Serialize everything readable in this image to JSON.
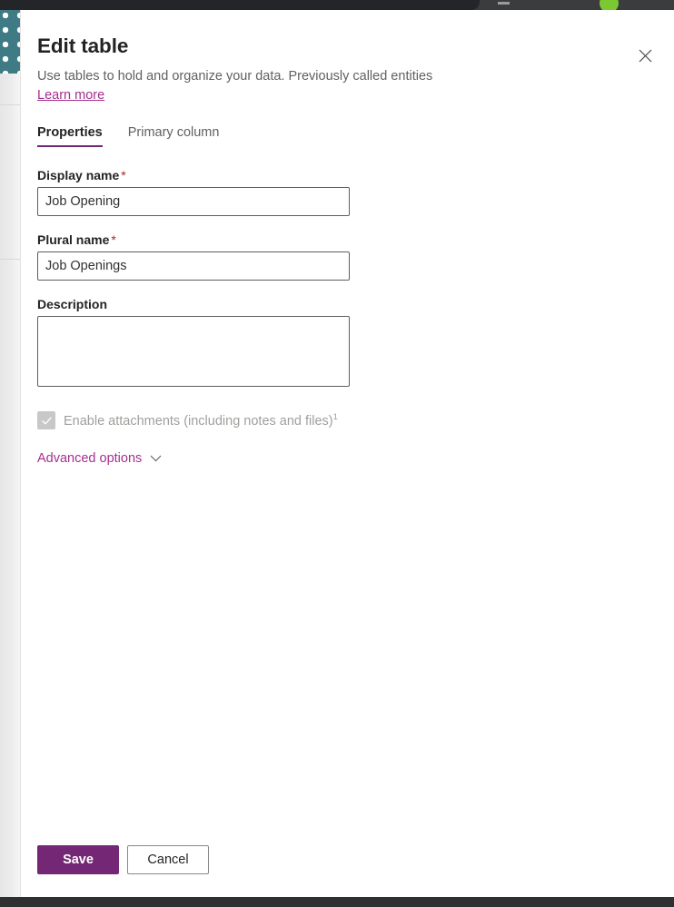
{
  "browser": {
    "account_indicator": "account-avatar-dot",
    "minimize_glyph": "minimize-icon"
  },
  "panel": {
    "title": "Edit table",
    "subtitle": "Use tables to hold and organize your data. Previously called entities",
    "learn_more_label": "Learn more",
    "close_icon_name": "close-icon",
    "tabs": [
      {
        "label": "Properties",
        "active": true
      },
      {
        "label": "Primary column",
        "active": false
      }
    ],
    "fields": {
      "display_name": {
        "label": "Display name",
        "required_marker": "*",
        "value": "Job Opening",
        "placeholder": ""
      },
      "plural_name": {
        "label": "Plural name",
        "required_marker": "*",
        "value": "Job Openings",
        "placeholder": ""
      },
      "description": {
        "label": "Description",
        "value": "",
        "placeholder": ""
      }
    },
    "attachments": {
      "label": "Enable attachments (including notes and files)",
      "footnote_marker": "1",
      "checked": true,
      "disabled": true
    },
    "advanced_options": {
      "label": "Advanced options",
      "chevron_icon_name": "chevron-down-icon",
      "expanded": false
    },
    "footer": {
      "save_label": "Save",
      "cancel_label": "Cancel"
    }
  },
  "colors": {
    "accent_purple": "#742774",
    "link_purple": "#a4308f",
    "required_red": "#a4262c",
    "banner_teal": "#3e7b85",
    "account_green": "#7cc832"
  }
}
